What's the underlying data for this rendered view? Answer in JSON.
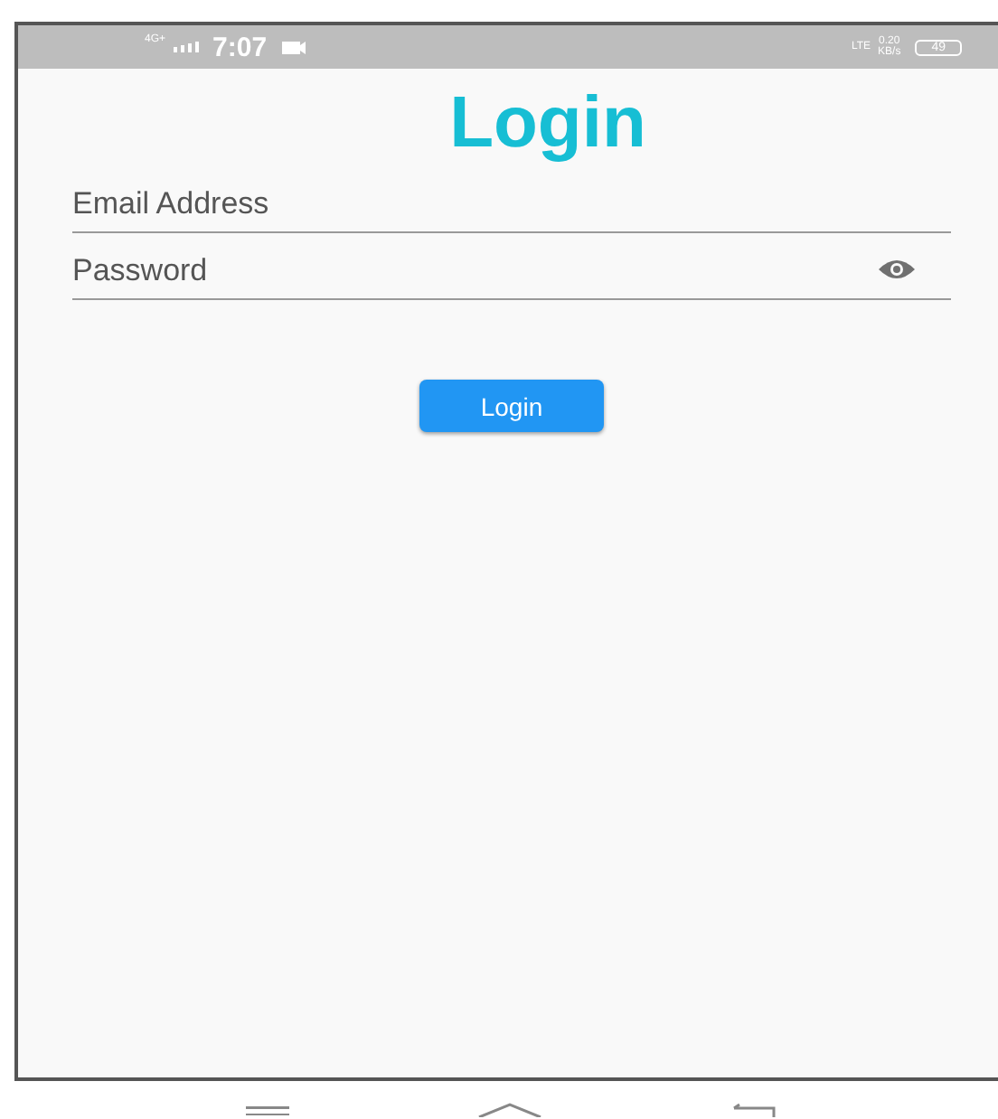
{
  "status_bar": {
    "network": "4G+",
    "time": "7:07",
    "speed": "0.20",
    "speed_unit": "KB/s",
    "lte": "LTE",
    "battery": "49"
  },
  "title": "Login",
  "fields": [
    {
      "placeholder": "Email Address",
      "kind": "text"
    },
    {
      "placeholder": "Password",
      "kind": "password"
    }
  ],
  "button": "Login"
}
